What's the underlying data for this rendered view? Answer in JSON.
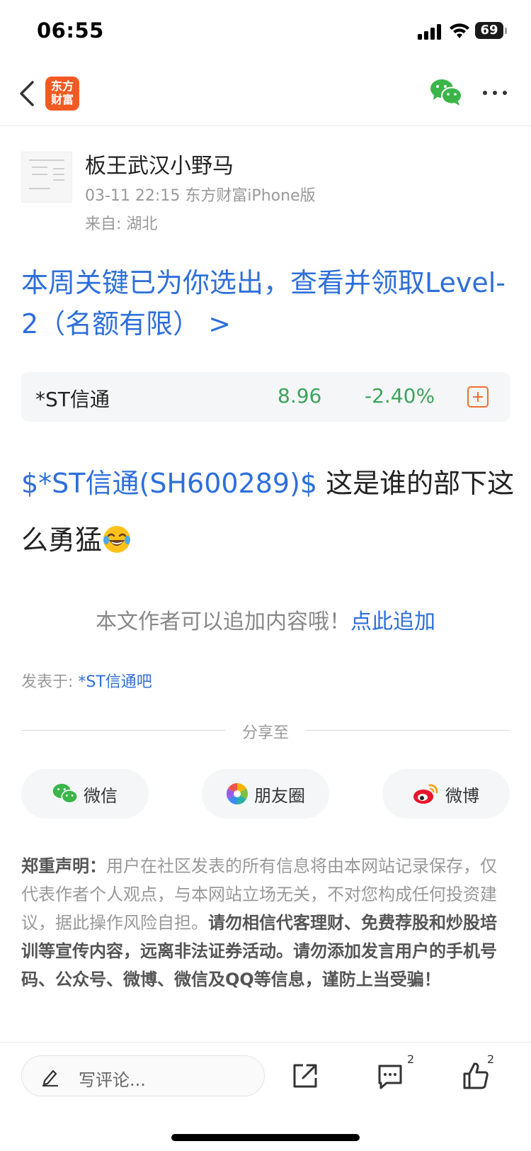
{
  "status_bar": {
    "time": "06:55",
    "battery": "69"
  },
  "nav": {
    "logo_line1": "东方",
    "logo_line2": "财富"
  },
  "author": {
    "name": "板王武汉小野马",
    "meta": "03-11 22:15 东方财富iPhone版",
    "location": "来自: 湖北"
  },
  "promo": {
    "text": "本周关键已为你选出，查看并领取Level-2（名额有限） >"
  },
  "stock": {
    "name": "*ST信通",
    "price": "8.96",
    "change": "-2.40%",
    "color_down": "#3aa45a"
  },
  "post": {
    "stock_tag": "$*ST信通(SH600289)$",
    "text": " 这是谁的部下这么勇猛"
  },
  "append": {
    "prompt": "本文作者可以追加内容哦！",
    "link": "点此追加"
  },
  "posted_in": {
    "label": "发表于: ",
    "forum": "*ST信通吧"
  },
  "share": {
    "title": "分享至",
    "buttons": [
      {
        "label": "微信",
        "icon": "wechat-icon"
      },
      {
        "label": "朋友圈",
        "icon": "moments-icon"
      },
      {
        "label": "微博",
        "icon": "weibo-icon"
      }
    ]
  },
  "disclaimer": {
    "heading": "郑重声明：",
    "body": "用户在社区发表的所有信息将由本网站记录保存，仅代表作者个人观点，与本网站立场无关，不对您构成任何投资建议，据此操作风险自担。",
    "warning": "请勿相信代客理财、免费荐股和炒股培训等宣传内容，远离非法证券活动。请勿添加发言用户的手机号码、公众号、微博、微信及QQ等信息，谨防上当受骗！"
  },
  "bottom_bar": {
    "comment_placeholder": "写评论...",
    "comment_count": "2",
    "like_count": "2"
  },
  "colors": {
    "link": "#2e6fd9",
    "brand": "#f25a24",
    "accent": "#f0702a"
  }
}
